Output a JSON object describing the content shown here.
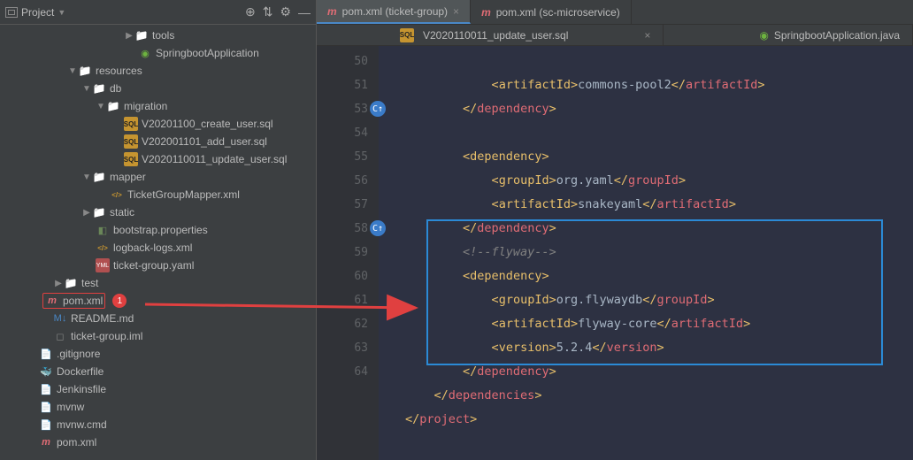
{
  "header": {
    "title": "Project"
  },
  "tree": {
    "tools": "tools",
    "springApp": "SpringbootApplication",
    "resources": "resources",
    "db": "db",
    "migration": "migration",
    "m1": "V20201100_create_user.sql",
    "m2": "V202001101_add_user.sql",
    "m3": "V2020110011_update_user.sql",
    "mapper": "mapper",
    "mapperFile": "TicketGroupMapper.xml",
    "static": "static",
    "bootstrap": "bootstrap.properties",
    "logback": "logback-logs.xml",
    "ticketYaml": "ticket-group.yaml",
    "test": "test",
    "pom": "pom.xml",
    "badge": "1",
    "readme": "README.md",
    "ticketIml": "ticket-group.iml",
    "gitignore": ".gitignore",
    "dockerfile": "Dockerfile",
    "jenkins": "Jenkinsfile",
    "mvnw": "mvnw",
    "mvnwcmd": "mvnw.cmd",
    "pom2": "pom.xml"
  },
  "tabs": {
    "t1": "pom.xml (ticket-group)",
    "t2": "pom.xml (sc-microservice)",
    "s1": "V2020110011_update_user.sql",
    "s2": "SpringbootApplication.java"
  },
  "gutter": [
    "50",
    "51",
    "",
    "53",
    "54",
    "55",
    "56",
    "57",
    "58",
    "59",
    "60",
    "61",
    "62",
    "63",
    "64"
  ]
}
